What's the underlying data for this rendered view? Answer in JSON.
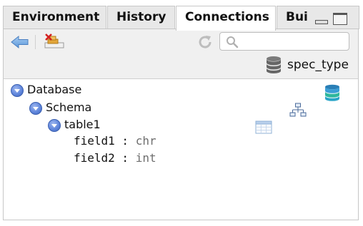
{
  "tabs": [
    {
      "label": "Environment"
    },
    {
      "label": "History"
    },
    {
      "label": "Connections",
      "active": true
    },
    {
      "label": "Build"
    }
  ],
  "search": {
    "value": "",
    "placeholder": ""
  },
  "spec": {
    "label": "spec_type"
  },
  "tree": {
    "database": {
      "label": "Database"
    },
    "schema": {
      "label": "Schema"
    },
    "table": {
      "label": "table1"
    },
    "fields": [
      {
        "name": "field1",
        "sep": " : ",
        "type": "chr"
      },
      {
        "name": "field2",
        "sep": " : ",
        "type": "int"
      }
    ]
  },
  "icons": {
    "back": "back-arrow-icon",
    "disconnect": "disconnect-icon",
    "refresh": "refresh-icon",
    "search": "search-icon",
    "spec": "database-icon",
    "database": "database-color-icon",
    "schema": "schema-icon",
    "table": "table-icon"
  },
  "colors": {
    "active_tab_bg": "#ffffff",
    "inactive_tab_bg": "#e8e8e8",
    "toolbar_bg": "#f0f0f0",
    "toggle_blue": "#5b83d8",
    "field_type": "#6e6e6e"
  }
}
